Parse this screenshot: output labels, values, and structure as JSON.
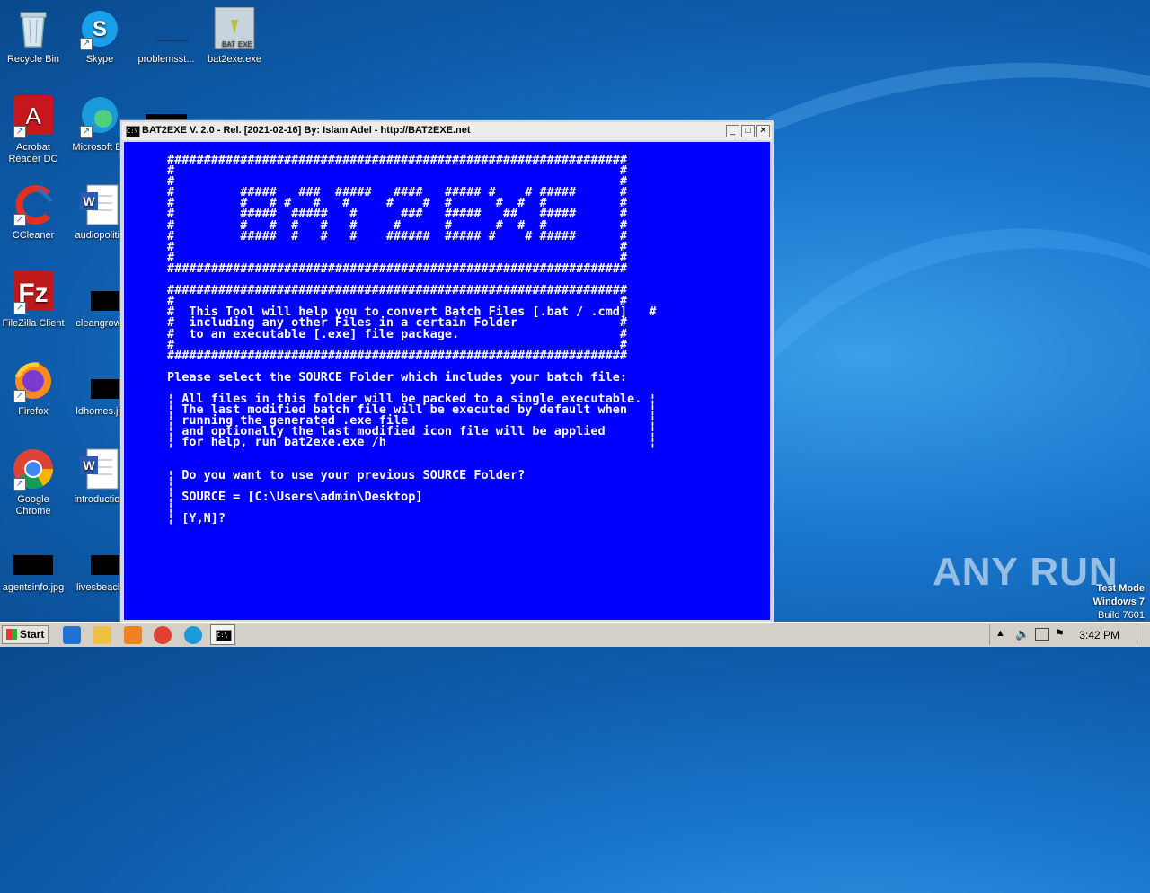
{
  "desktop": {
    "icons": [
      {
        "label": "Recycle Bin",
        "icon": "recycle-bin-icon"
      },
      {
        "label": "Skype",
        "icon": "skype-icon"
      },
      {
        "label": "problemsst...",
        "icon": "file-icon"
      },
      {
        "label": "bat2exe.exe",
        "icon": "bat2exe-icon"
      },
      {
        "label": "Acrobat Reader DC",
        "icon": "acrobat-icon"
      },
      {
        "label": "Microsoft Ed",
        "icon": "edge-icon"
      },
      {
        "label": "CCleaner",
        "icon": "ccleaner-icon"
      },
      {
        "label": "audiopolitic",
        "icon": "word-doc-icon"
      },
      {
        "label": "FileZilla Client",
        "icon": "filezilla-icon"
      },
      {
        "label": "cleangrowt",
        "icon": "image-file-icon"
      },
      {
        "label": "Firefox",
        "icon": "firefox-icon"
      },
      {
        "label": "ldhomes.jp",
        "icon": "image-file-icon"
      },
      {
        "label": "Google Chrome",
        "icon": "chrome-icon"
      },
      {
        "label": "introduction",
        "icon": "word-doc-icon"
      },
      {
        "label": "agentsinfo.jpg",
        "icon": "image-file-icon"
      },
      {
        "label": "livesbeach",
        "icon": "image-file-icon"
      }
    ]
  },
  "window": {
    "title": "BAT2EXE V. 2.0 - Rel. [2021-02-16] By: Islam Adel - http://BAT2EXE.net",
    "console_text": "###############################################################\n#                                                             #\n#                                                             #\n#         #####   ###  #####   ####   ##### #    # #####      #\n#         #   # #   #   #     #    #  #      #  #  #          #\n#         #####  #####   #      ###   #####   ##   #####      #\n#         #   #  #   #   #     #      #      #  #  #          #\n#         #####  #   #   #    ######  ##### #    # #####      #\n#                                                             #\n#                                                             #\n###############################################################\n\n###############################################################\n#                                                             #\n#  This Tool will help you to convert Batch Files [.bat / .cmd]   #\n#  including any other Files in a certain Folder              #\n#  to an executable [.exe] file package.                      #\n#                                                             #\n###############################################################\n\nPlease select the SOURCE Folder which includes your batch file:\n\n¦ All files in this folder will be packed to a single executable. ¦\n¦ The last modified batch file will be executed by default when   ¦\n¦ running the generated .exe file                                 ¦\n¦ and optionally the last modified icon file will be applied      ¦\n¦ for help, run bat2exe.exe /h                                    ¦\n\n\n¦ Do you want to use your previous SOURCE Folder?\n¦\n¦ SOURCE = [C:\\Users\\admin\\Desktop]\n¦\n¦ [Y,N]?",
    "buttons": {
      "minimize": "_",
      "maximize": "□",
      "close": "✕"
    }
  },
  "watermark": {
    "brand": "ANY  RUN",
    "test_mode": "Test Mode",
    "os": "Windows 7",
    "build": "Build 7601"
  },
  "taskbar": {
    "start_label": "Start",
    "pinned": [
      {
        "name": "ie-icon",
        "color": "#1e73d6"
      },
      {
        "name": "explorer-icon",
        "color": "#f0c040"
      },
      {
        "name": "media-player-icon",
        "color": "#f08020"
      },
      {
        "name": "chrome-icon",
        "color": "#e04030"
      },
      {
        "name": "edge-icon",
        "color": "#1a9ad8"
      }
    ],
    "active_window_icon": "cmd-icon",
    "clock": "3:42 PM"
  }
}
